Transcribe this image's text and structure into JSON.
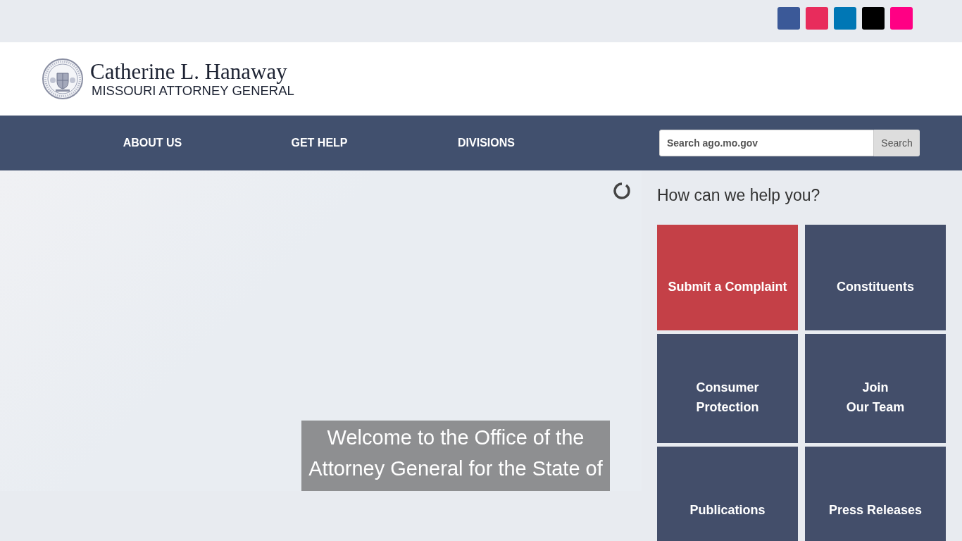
{
  "social_links": [
    {
      "color": "#3b5998"
    },
    {
      "color": "#e82c5c"
    },
    {
      "color": "#0077b5"
    },
    {
      "color": "#000000"
    },
    {
      "color": "#ff0084"
    }
  ],
  "header": {
    "name": "Catherine L. Hanaway",
    "subtitle": "MISSOURI ATTORNEY GENERAL"
  },
  "nav": {
    "items": [
      "ABOUT US",
      "GET HELP",
      "DIVISIONS"
    ],
    "search": {
      "placeholder": "Search ago.mo.gov",
      "button": "Search"
    }
  },
  "slider": {
    "caption_lines": [
      "Welcome to the Office of the",
      "Attorney General for the State of"
    ]
  },
  "help": {
    "title": "How can we help you?",
    "tiles": [
      {
        "lines": [
          "Submit a Complaint"
        ],
        "color": "#c44047"
      },
      {
        "lines": [
          "Constituents"
        ],
        "color": "#434e6a"
      },
      {
        "lines": [
          "Consumer",
          "Protection"
        ],
        "color": "#434e6a"
      },
      {
        "lines": [
          "Join",
          "Our Team"
        ],
        "color": "#434e6a"
      },
      {
        "lines": [
          "Publications"
        ],
        "color": "#434e6a"
      },
      {
        "lines": [
          "Press Releases"
        ],
        "color": "#434e6a"
      }
    ]
  }
}
